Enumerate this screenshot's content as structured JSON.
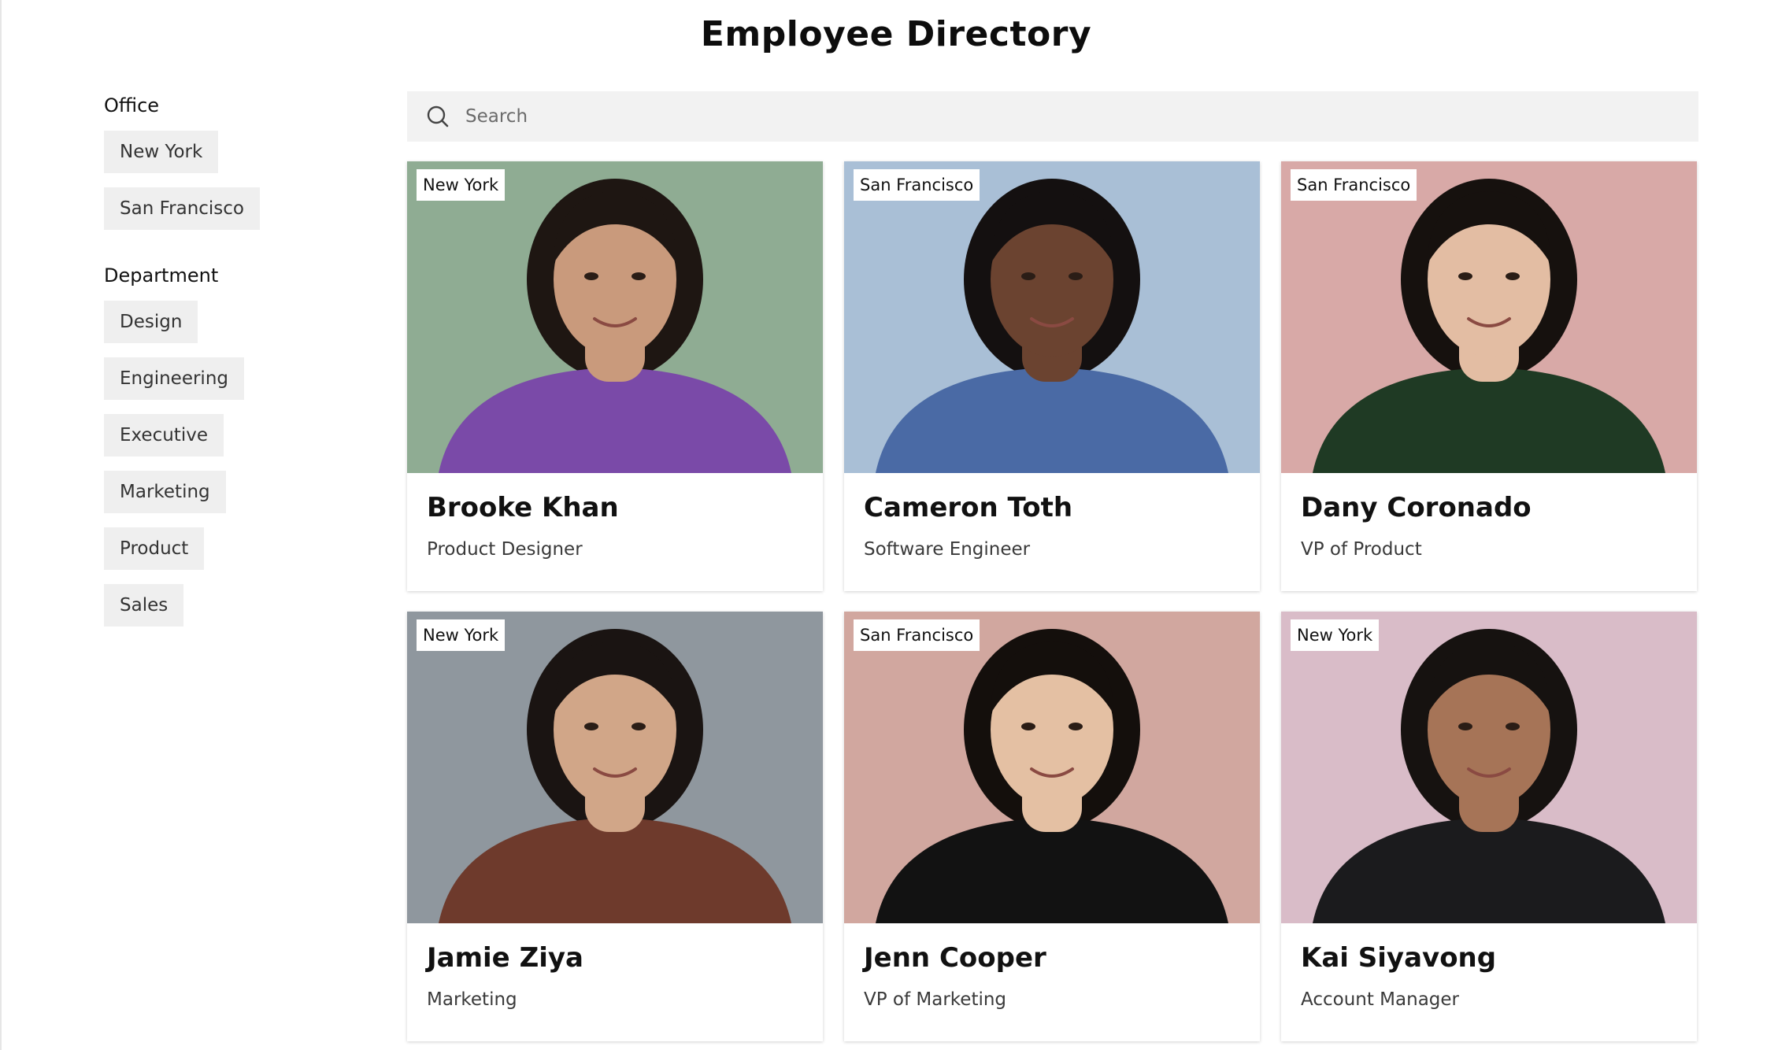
{
  "page": {
    "title": "Employee Directory"
  },
  "filters": {
    "office": {
      "heading": "Office",
      "options": [
        "New York",
        "San Francisco"
      ]
    },
    "department": {
      "heading": "Department",
      "options": [
        "Design",
        "Engineering",
        "Executive",
        "Marketing",
        "Product",
        "Sales"
      ]
    }
  },
  "search": {
    "placeholder": "Search",
    "icon": "search-icon"
  },
  "employees": [
    {
      "name": "Brooke Khan",
      "title": "Product Designer",
      "office": "New York",
      "bg": "#8fac93",
      "shirt": "#7a4aa8",
      "skin": "#c99a7c",
      "hair": "#1e1612"
    },
    {
      "name": "Cameron Toth",
      "title": "Software Engineer",
      "office": "San Francisco",
      "bg": "#a9bfd6",
      "shirt": "#4a6aa5",
      "skin": "#6b4330",
      "hair": "#141010"
    },
    {
      "name": "Dany Coronado",
      "title": "VP of Product",
      "office": "San Francisco",
      "bg": "#d8a9a7",
      "shirt": "#1f3a24",
      "skin": "#e3bda3",
      "hair": "#16110e"
    },
    {
      "name": "Jamie Ziya",
      "title": "Marketing",
      "office": "New York",
      "bg": "#8f979e",
      "shirt": "#6e3a2c",
      "skin": "#d1a688",
      "hair": "#1a1412"
    },
    {
      "name": "Jenn Cooper",
      "title": "VP of Marketing",
      "office": "San Francisco",
      "bg": "#d1a79f",
      "shirt": "#121212",
      "skin": "#e4c0a3",
      "hair": "#140f0c"
    },
    {
      "name": "Kai Siyavong",
      "title": "Account Manager",
      "office": "New York",
      "bg": "#d9bcc8",
      "shirt": "#1b1b1d",
      "skin": "#a67457",
      "hair": "#161210"
    }
  ]
}
